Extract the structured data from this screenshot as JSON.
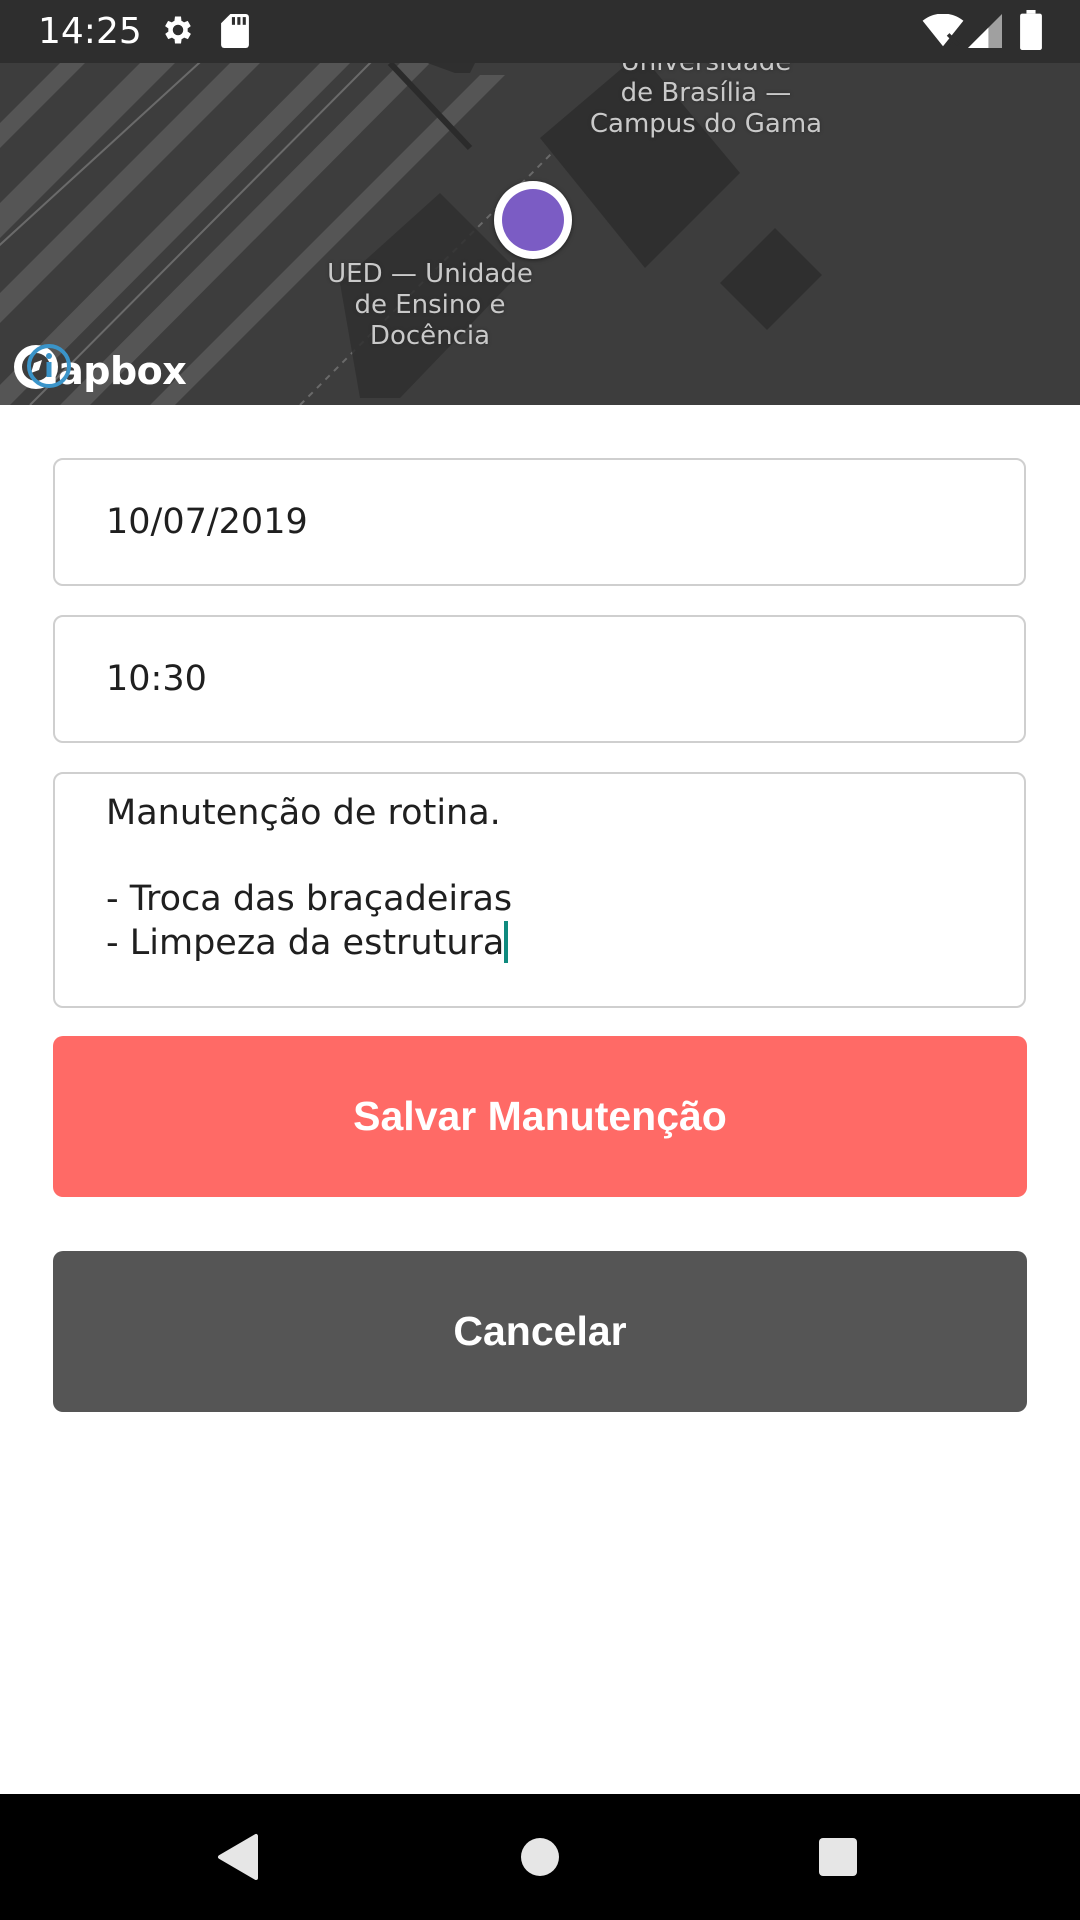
{
  "status_bar": {
    "time": "14:25",
    "icons": [
      "gear-icon",
      "sd-card-icon",
      "wifi-icon",
      "signal-icon",
      "battery-icon"
    ]
  },
  "map": {
    "labels": {
      "campus": "Universidade\nde Brasília —\nCampus do Gama",
      "ued": "UED — Unidade\nde Ensino e\nDocência"
    },
    "attribution": "mapbox",
    "marker_color": "#7b5cc4"
  },
  "form": {
    "date_value": "10/07/2019",
    "time_value": "10:30",
    "description_lines": [
      "Manutenção de rotina.",
      "",
      "- Troca das braçadeiras",
      "- Limpeza da estrutura"
    ]
  },
  "buttons": {
    "save_label": "Salvar Manutenção",
    "save_color": "#ff6a66",
    "cancel_label": "Cancelar",
    "cancel_color": "#555555"
  },
  "nav": {
    "icons": [
      "back-icon",
      "home-icon",
      "recents-icon"
    ]
  }
}
